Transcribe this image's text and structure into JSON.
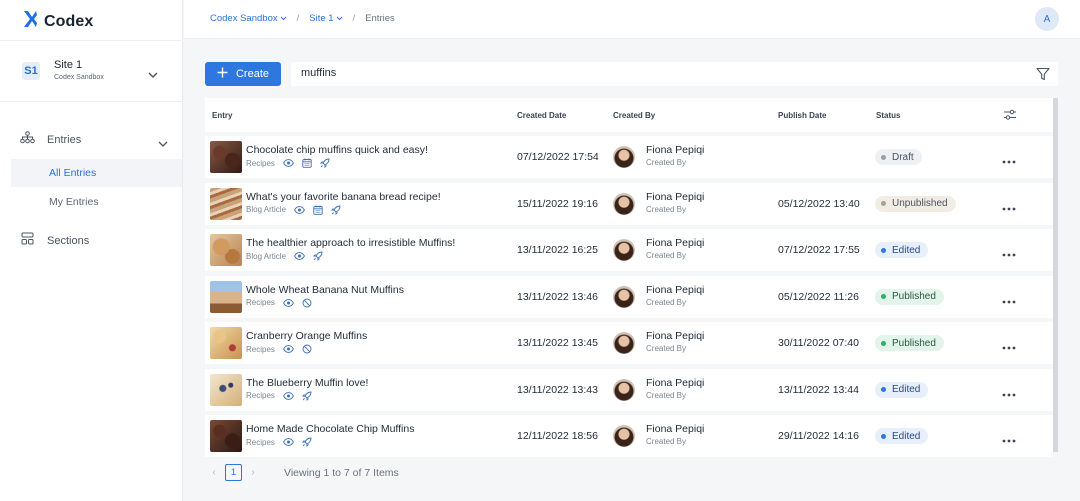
{
  "app": {
    "name": "Codex"
  },
  "site": {
    "badge": "S1",
    "name": "Site 1",
    "sub": "Codex Sandbox"
  },
  "sidebar": {
    "entries_label": "Entries",
    "all_entries": "All Entries",
    "my_entries": "My Entries",
    "sections": "Sections"
  },
  "breadcrumb": {
    "org": "Codex Sandbox",
    "site": "Site 1",
    "page": "Entries"
  },
  "user": {
    "initial": "A"
  },
  "toolbar": {
    "create_label": "Create",
    "search_value": "muffins"
  },
  "table": {
    "headers": {
      "entry": "Entry",
      "created_date": "Created Date",
      "created_by": "Created By",
      "publish_date": "Publish Date",
      "status": "Status"
    },
    "rows": [
      {
        "title": "Chocolate chip muffins quick and easy!",
        "type": "Recipes",
        "icons": [
          "eye-icon",
          "calendar-icon",
          "rocket-icon"
        ],
        "created": "07/12/2022 17:54",
        "by": "Fiona Pepiqi",
        "by_sub": "Created By",
        "publish": "",
        "status": "Draft"
      },
      {
        "title": "What's your favorite banana bread recipe!",
        "type": "Blog Article",
        "icons": [
          "eye-icon",
          "calendar-icon",
          "rocket-icon"
        ],
        "created": "15/11/2022 19:16",
        "by": "Fiona Pepiqi",
        "by_sub": "Created By",
        "publish": "05/12/2022 13:40",
        "status": "Unpublished"
      },
      {
        "title": "The healthier approach to irresistible Muffins!",
        "type": "Blog Article",
        "icons": [
          "eye-icon",
          "rocket-icon"
        ],
        "created": "13/11/2022 16:25",
        "by": "Fiona Pepiqi",
        "by_sub": "Created By",
        "publish": "07/12/2022 17:55",
        "status": "Edited"
      },
      {
        "title": "Whole Wheat Banana Nut Muffins",
        "type": "Recipes",
        "icons": [
          "eye-icon",
          "no-entry-icon"
        ],
        "created": "13/11/2022 13:46",
        "by": "Fiona Pepiqi",
        "by_sub": "Created By",
        "publish": "05/12/2022 11:26",
        "status": "Published"
      },
      {
        "title": "Cranberry Orange Muffins",
        "type": "Recipes",
        "icons": [
          "eye-icon",
          "no-entry-icon"
        ],
        "created": "13/11/2022 13:45",
        "by": "Fiona Pepiqi",
        "by_sub": "Created By",
        "publish": "30/11/2022 07:40",
        "status": "Published"
      },
      {
        "title": "The Blueberry Muffin love!",
        "type": "Recipes",
        "icons": [
          "eye-icon",
          "rocket-icon"
        ],
        "created": "13/11/2022 13:43",
        "by": "Fiona Pepiqi",
        "by_sub": "Created By",
        "publish": "13/11/2022 13:44",
        "status": "Edited"
      },
      {
        "title": "Home Made Chocolate Chip Muffins",
        "type": "Recipes",
        "icons": [
          "eye-icon",
          "rocket-icon"
        ],
        "created": "12/11/2022 18:56",
        "by": "Fiona Pepiqi",
        "by_sub": "Created By",
        "publish": "29/11/2022 14:16",
        "status": "Edited"
      }
    ]
  },
  "status_colors": {
    "Draft": {
      "bg": "#eef0f3",
      "dot": "#9aa1ab",
      "text": "#4a5462"
    },
    "Unpublished": {
      "bg": "#f2ede4",
      "dot": "#a8a294",
      "text": "#4a5462"
    },
    "Edited": {
      "bg": "#e7effb",
      "dot": "#2f77e0",
      "text": "#2b4a78"
    },
    "Published": {
      "bg": "#e3f4ea",
      "dot": "#2fae66",
      "text": "#2a5a3e"
    }
  },
  "pagination": {
    "page": "1",
    "info": "Viewing 1 to 7 of 7 Items"
  },
  "colors": {
    "accent": "#2f77e0",
    "brand": "#1e6fe0"
  }
}
